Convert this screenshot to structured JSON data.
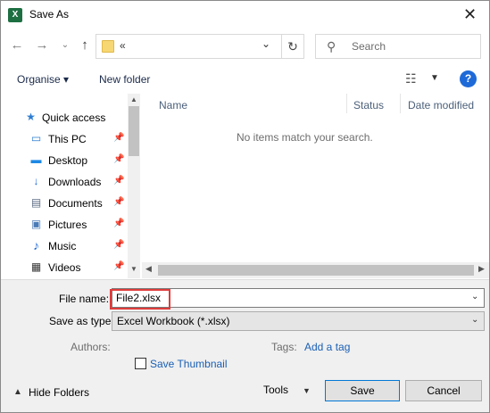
{
  "window": {
    "title": "Save As",
    "app_icon_letter": "X"
  },
  "address": {
    "path": "«",
    "search_placeholder": "Search"
  },
  "toolbar": {
    "organise_label": "Organise ▾",
    "new_folder_label": "New folder",
    "help_label": "?"
  },
  "nav": {
    "items": [
      {
        "label": "Quick access",
        "icon": "star-icon",
        "glyph": "★",
        "color": "#2d7dd2"
      },
      {
        "label": "This PC",
        "icon": "computer-icon",
        "glyph": "▭",
        "color": "#2d7dd2"
      },
      {
        "label": "Desktop",
        "icon": "desktop-icon",
        "glyph": "▬",
        "color": "#1e88e5"
      },
      {
        "label": "Downloads",
        "icon": "download-icon",
        "glyph": "↓",
        "color": "#1e6ad8"
      },
      {
        "label": "Documents",
        "icon": "document-icon",
        "glyph": "▤",
        "color": "#5a6b82"
      },
      {
        "label": "Pictures",
        "icon": "picture-icon",
        "glyph": "▣",
        "color": "#4a7bb7"
      },
      {
        "label": "Music",
        "icon": "music-icon",
        "glyph": "♪",
        "color": "#1e6ad8"
      },
      {
        "label": "Videos",
        "icon": "video-icon",
        "glyph": "▦",
        "color": "#333333"
      }
    ]
  },
  "filelist": {
    "columns": [
      "Name",
      "Status",
      "Date modified"
    ],
    "empty_message": "No items match your search."
  },
  "form": {
    "file_name_label": "File name:",
    "file_name_value": "File2.xlsx",
    "save_type_label": "Save as type:",
    "save_type_value": "Excel Workbook (*.xlsx)",
    "authors_label": "Authors:",
    "tags_label": "Tags:",
    "add_tag_label": "Add a tag",
    "save_thumbnail_label": "Save Thumbnail",
    "save_thumbnail_checked": false
  },
  "footer": {
    "hide_folders_label": "Hide Folders",
    "tools_label": "Tools",
    "save_label": "Save",
    "cancel_label": "Cancel"
  },
  "colors": {
    "accent": "#0078d7",
    "highlight": "#e03c3c",
    "link": "#1a5fb4"
  }
}
